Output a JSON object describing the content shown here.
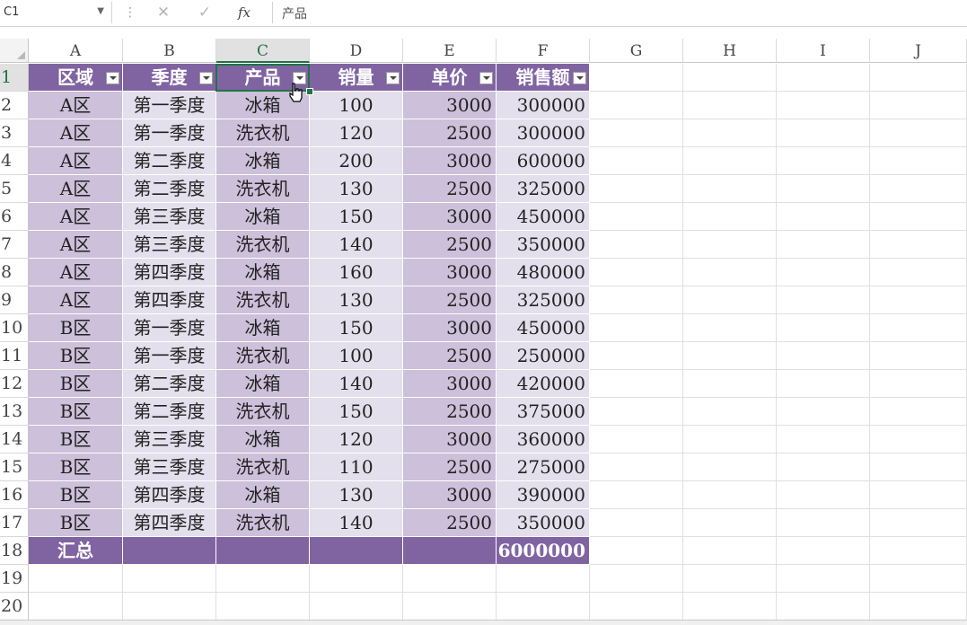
{
  "name_box": {
    "value": "C1"
  },
  "formula_bar": {
    "fx_label": "fx",
    "content": "产品"
  },
  "columns": [
    "A",
    "B",
    "C",
    "D",
    "E",
    "F",
    "G",
    "H",
    "I",
    "J"
  ],
  "rows": [
    "1",
    "2",
    "3",
    "4",
    "5",
    "6",
    "7",
    "8",
    "9",
    "10",
    "11",
    "12",
    "13",
    "14",
    "15",
    "16",
    "17",
    "18",
    "19",
    "20"
  ],
  "table": {
    "headers": [
      "区域",
      "季度",
      "产品",
      "销量",
      "单价",
      "销售额"
    ],
    "rows": [
      [
        "A区",
        "第一季度",
        "冰箱",
        "100",
        "3000",
        "300000"
      ],
      [
        "A区",
        "第一季度",
        "洗衣机",
        "120",
        "2500",
        "300000"
      ],
      [
        "A区",
        "第二季度",
        "冰箱",
        "200",
        "3000",
        "600000"
      ],
      [
        "A区",
        "第二季度",
        "洗衣机",
        "130",
        "2500",
        "325000"
      ],
      [
        "A区",
        "第三季度",
        "冰箱",
        "150",
        "3000",
        "450000"
      ],
      [
        "A区",
        "第三季度",
        "洗衣机",
        "140",
        "2500",
        "350000"
      ],
      [
        "A区",
        "第四季度",
        "冰箱",
        "160",
        "3000",
        "480000"
      ],
      [
        "A区",
        "第四季度",
        "洗衣机",
        "130",
        "2500",
        "325000"
      ],
      [
        "B区",
        "第一季度",
        "冰箱",
        "150",
        "3000",
        "450000"
      ],
      [
        "B区",
        "第一季度",
        "洗衣机",
        "100",
        "2500",
        "250000"
      ],
      [
        "B区",
        "第二季度",
        "冰箱",
        "140",
        "3000",
        "420000"
      ],
      [
        "B区",
        "第二季度",
        "洗衣机",
        "150",
        "2500",
        "375000"
      ],
      [
        "B区",
        "第三季度",
        "冰箱",
        "120",
        "3000",
        "360000"
      ],
      [
        "B区",
        "第三季度",
        "洗衣机",
        "110",
        "2500",
        "275000"
      ],
      [
        "B区",
        "第四季度",
        "冰箱",
        "130",
        "3000",
        "390000"
      ],
      [
        "B区",
        "第四季度",
        "洗衣机",
        "140",
        "2500",
        "350000"
      ]
    ],
    "total_row": [
      "汇总",
      "",
      "",
      "",
      "",
      "6000000"
    ]
  },
  "colors": {
    "header": "#8064a2",
    "band_dark": "#ccc0da",
    "band_light": "#e4dfec",
    "accent": "#217346"
  },
  "icons": {
    "cancel": "close-icon",
    "enter": "check-icon",
    "cursor": "hand-cursor-icon"
  }
}
